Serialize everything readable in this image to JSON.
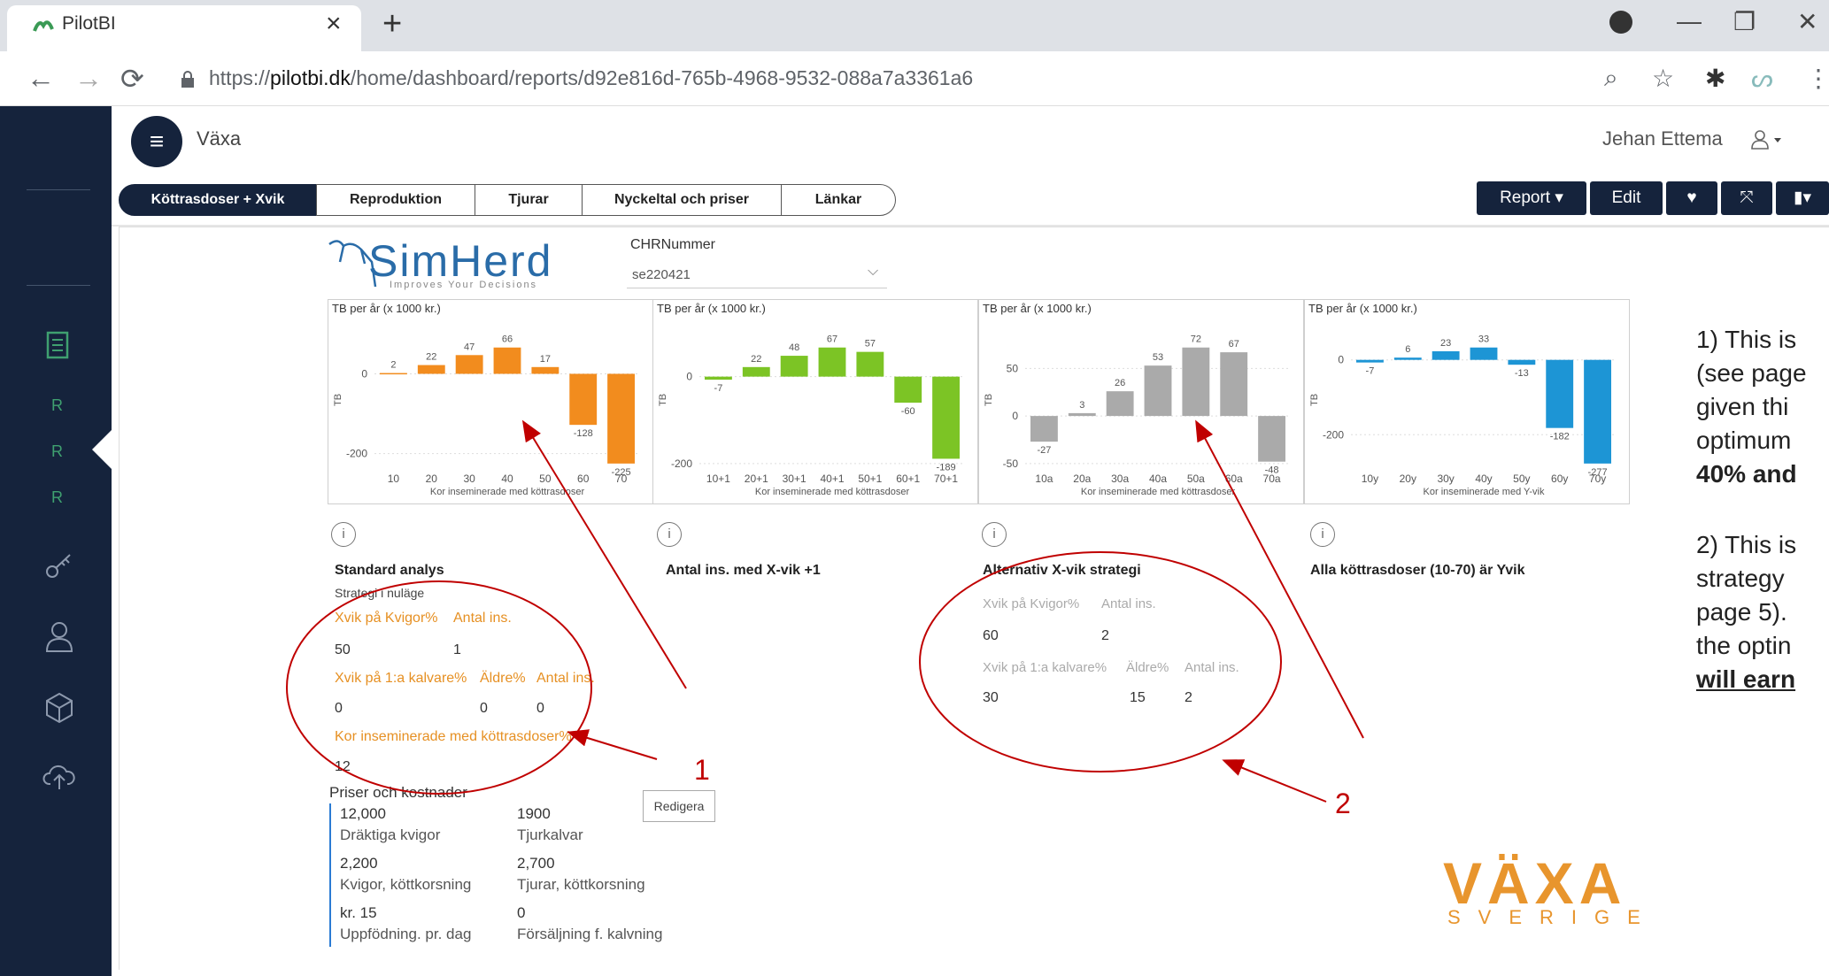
{
  "browser": {
    "tab_title": "PilotBI",
    "tab_close": "×",
    "new_tab": "+",
    "url_prefix": "https://",
    "url_domain": "pilotbi.dk",
    "url_path": "/home/dashboard/reports/d92e816d-765b-4968-9532-088a7a3361a6"
  },
  "app": {
    "name": "Växa",
    "user": "Jehan Ettema",
    "sidebar_letters": [
      "R",
      "R",
      "R"
    ]
  },
  "page_tabs": [
    "Köttrasdoser + Xvik",
    "Reproduktion",
    "Tjurar",
    "Nyckeltal och priser",
    "Länkar"
  ],
  "report_buttons": {
    "report": "Report",
    "edit": "Edit"
  },
  "slicer": {
    "label": "CHRNummer",
    "value": "se220421"
  },
  "logo": {
    "simherd": "SimHerd",
    "simherd_tagline": "Improves Your Decisions",
    "vaxa": "VÄXA",
    "vaxa_sub": "SVERIGE"
  },
  "accent_colors": {
    "orange": "#f28c1e",
    "green": "#7cc425",
    "gray": "#aaaaaa",
    "blue": "#1d95d5",
    "annotation_red": "#c00000"
  },
  "chart_data": [
    {
      "type": "bar",
      "title": "TB per år (x 1000 kr.)",
      "ylabel": "TB",
      "xlabel": "Kor inseminerade med köttrasdoser",
      "categories": [
        "10",
        "20",
        "30",
        "40",
        "50",
        "60",
        "70"
      ],
      "values": [
        2,
        22,
        47,
        66,
        17,
        -128,
        -225
      ],
      "yticks": [
        0,
        -200
      ],
      "color": "#f28c1e"
    },
    {
      "type": "bar",
      "title": "TB per år (x 1000 kr.)",
      "ylabel": "TB",
      "xlabel": "Kor inseminerade med köttrasdoser",
      "categories": [
        "10+1",
        "20+1",
        "30+1",
        "40+1",
        "50+1",
        "60+1",
        "70+1"
      ],
      "values": [
        -7,
        22,
        48,
        67,
        57,
        -60,
        -189
      ],
      "yticks": [
        0,
        -200
      ],
      "color": "#7cc425"
    },
    {
      "type": "bar",
      "title": "TB per år (x 1000 kr.)",
      "ylabel": "TB",
      "xlabel": "Kor inseminerade med köttrasdoser",
      "categories": [
        "10a",
        "20a",
        "30a",
        "40a",
        "50a",
        "60a",
        "70a"
      ],
      "values": [
        -27,
        3,
        26,
        53,
        72,
        67,
        -48
      ],
      "yticks": [
        50,
        0,
        -50
      ],
      "color": "#aaaaaa"
    },
    {
      "type": "bar",
      "title": "TB per år (x 1000 kr.)",
      "ylabel": "TB",
      "xlabel": "Kor inseminerade med Y-vik",
      "categories": [
        "10y",
        "20y",
        "30y",
        "40y",
        "50y",
        "60y",
        "70y"
      ],
      "values": [
        -7,
        6,
        23,
        33,
        -13,
        -182,
        -277
      ],
      "yticks": [
        0,
        -200
      ],
      "color": "#1d95d5"
    }
  ],
  "panels": {
    "standard": {
      "title": "Standard analys",
      "subtitle": "Strategi i nuläge",
      "row1_labels": [
        "Xvik på Kvigor%",
        "Antal ins."
      ],
      "row1_values": [
        "50",
        "1"
      ],
      "row2_labels": [
        "Xvik på 1:a kalvare%",
        "Äldre%",
        "Antal ins."
      ],
      "row2_values": [
        "0",
        "0",
        "0"
      ],
      "row3_label": "Kor inseminerade med köttrasdoser%",
      "row3_value": "12"
    },
    "antal": {
      "title": "Antal ins. med X-vik +1"
    },
    "alternativ": {
      "title": "Alternativ X-vik strategi",
      "row1_labels": [
        "Xvik på Kvigor%",
        "Antal ins."
      ],
      "row1_values": [
        "60",
        "2"
      ],
      "row2_labels": [
        "Xvik på 1:a kalvare%",
        "Äldre%",
        "Antal ins."
      ],
      "row2_values": [
        "30",
        "15",
        "2"
      ]
    },
    "alla": {
      "title": "Alla köttrasdoser (10-70) är Yvik"
    }
  },
  "prices": {
    "title": "Priser och kostnader",
    "items": [
      {
        "value": "12,000",
        "label": "Dräktiga kvigor"
      },
      {
        "value": "1900",
        "label": "Tjurkalvar"
      },
      {
        "value": "2,200",
        "label": "Kvigor, köttkorsning"
      },
      {
        "value": "2,700",
        "label": "Tjurar, köttkorsning"
      },
      {
        "value": "kr. 15",
        "label": "Uppfödning. pr. dag"
      },
      {
        "value": "0",
        "label": "Försäljning f. kalvning"
      }
    ],
    "edit": "Redigera"
  },
  "annotations": {
    "n1": "1",
    "n2": "2",
    "lines": [
      "1) This is",
      "(see page",
      "given thi",
      "optimum",
      "40% and",
      "2) This is",
      "strategy",
      "page 5). ",
      "the optin",
      "will earn"
    ]
  }
}
